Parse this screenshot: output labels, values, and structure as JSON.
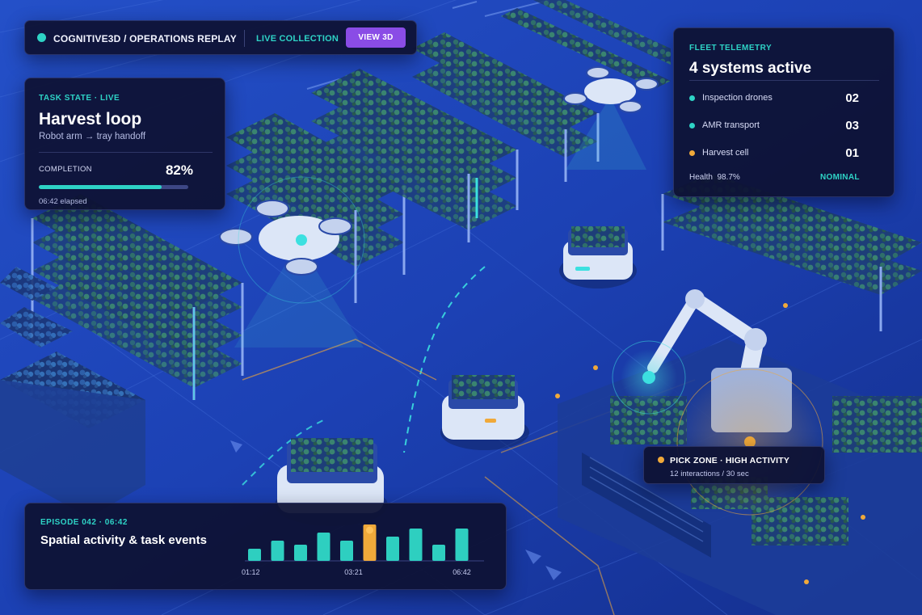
{
  "topbar": {
    "brand": "COGNITIVE3D / OPERATIONS REPLAY",
    "live_label": "LIVE COLLECTION",
    "view3d_label": "VIEW 3D"
  },
  "task": {
    "eyebrow": "TASK STATE · LIVE",
    "title": "Harvest loop",
    "subtitle": "Robot arm → tray handoff",
    "completion_label": "COMPLETION",
    "completion_value": "82%",
    "completion_fraction": 0.82,
    "elapsed": "06:42 elapsed"
  },
  "fleet": {
    "eyebrow": "FLEET TELEMETRY",
    "title": "4 systems active",
    "rows": [
      {
        "name": "Inspection drones",
        "value": "02",
        "color": "#2ed3c6"
      },
      {
        "name": "AMR transport",
        "value": "03",
        "color": "#2ed3c6"
      },
      {
        "name": "Harvest cell",
        "value": "01",
        "color": "#f0a93a"
      }
    ],
    "health": "Health  98.7%",
    "status": "NOMINAL"
  },
  "pick_zone": {
    "title": "PICK ZONE · HIGH ACTIVITY",
    "subtitle": "12 interactions / 30 sec"
  },
  "episode": {
    "eyebrow": "EPISODE 042 · 06:42",
    "title": "Spatial activity & task events"
  },
  "chart_data": {
    "type": "bar",
    "values": [
      3,
      5,
      4,
      7,
      5,
      9,
      6,
      8,
      4,
      8
    ],
    "highlight_index": 5,
    "x_tick_labels": [
      "01:12",
      "03:21",
      "06:42"
    ],
    "ylim": [
      0,
      10
    ],
    "colors": {
      "normal": "#2ecfc0",
      "highlight": "#f0a93a",
      "highlight_dot": "#ffc259"
    }
  },
  "colors": {
    "accent": "#2ed3c6",
    "warning": "#f0a93a",
    "button": "#8a4ce6",
    "panel": "#0e1234"
  }
}
